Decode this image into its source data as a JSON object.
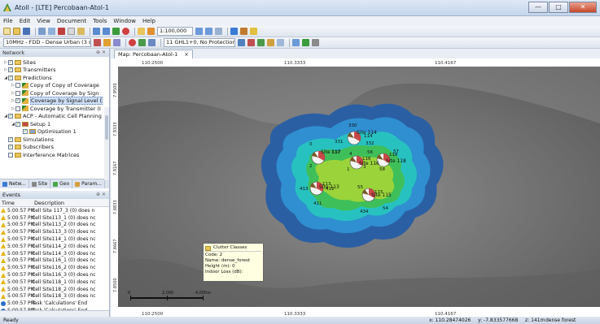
{
  "window": {
    "title": "Atoll - [LTE] Percobaan-Atol-1",
    "minimize": "—",
    "maximize": "□",
    "close": "✕"
  },
  "menu": [
    "File",
    "Edit",
    "View",
    "Document",
    "Tools",
    "Window",
    "Help"
  ],
  "toolbar": {
    "scale": "1:100,000",
    "frequency": "10MHz - FDD - Dense Urban (3 sec",
    "ghl": "11 GHL1+0, No Protection"
  },
  "network_panel": {
    "title": "Network",
    "items": [
      {
        "label": "Sites",
        "depth": 0,
        "twisty": "▷",
        "checked": true,
        "icon": "folder"
      },
      {
        "label": "Transmitters",
        "depth": 0,
        "twisty": "▷",
        "checked": true,
        "icon": "folder"
      },
      {
        "label": "Predictions",
        "depth": 0,
        "twisty": "◢",
        "checked": true,
        "icon": "folder"
      },
      {
        "label": "Copy of Copy of Coverage",
        "depth": 1,
        "twisty": "▷",
        "checked": false,
        "icon": "coverage"
      },
      {
        "label": "Copy of Coverage by Sign",
        "depth": 1,
        "twisty": "▷",
        "checked": false,
        "icon": "coverage"
      },
      {
        "label": "Coverage by Signal Level (",
        "depth": 1,
        "twisty": "▷",
        "checked": true,
        "icon": "coverage",
        "selected": true
      },
      {
        "label": "Coverage by Transmitter (I",
        "depth": 1,
        "twisty": "▷",
        "checked": false,
        "icon": "coverage"
      },
      {
        "label": "ACP - Automatic Cell Planning",
        "depth": 0,
        "twisty": "◢",
        "checked": true,
        "icon": "folder"
      },
      {
        "label": "Setup 1",
        "depth": 1,
        "twisty": "◢",
        "checked": true,
        "icon": "setup"
      },
      {
        "label": "Optimisation 1",
        "depth": 2,
        "twisty": "",
        "checked": true,
        "icon": "opt"
      },
      {
        "label": "Simulations",
        "depth": 0,
        "twisty": "",
        "checked": true,
        "icon": "folder"
      },
      {
        "label": "Subscribers",
        "depth": 0,
        "twisty": "",
        "checked": true,
        "icon": "folder"
      },
      {
        "label": "Interference Matrices",
        "depth": 0,
        "twisty": "",
        "checked": false,
        "icon": "folder"
      }
    ],
    "tabs": [
      {
        "label": "Netw...",
        "color": "#3a7bd5"
      },
      {
        "label": "Site",
        "color": "#888888"
      },
      {
        "label": "Geo",
        "color": "#4aa84a"
      },
      {
        "label": "Param...",
        "color": "#d4a040"
      }
    ]
  },
  "events_panel": {
    "title": "Events",
    "col_time": "Time",
    "col_desc": "Description",
    "rows": [
      {
        "time": "5:00:57 PM",
        "desc": "Cell Site 117_3 (0) does n"
      },
      {
        "time": "5:00:57 PM",
        "desc": "Cell Site113_1 (0) does nc"
      },
      {
        "time": "5:00:57 PM",
        "desc": "Cell Site113_2 (0) does nc"
      },
      {
        "time": "5:00:57 PM",
        "desc": "Cell Site113_3 (0) does nc"
      },
      {
        "time": "5:00:57 PM",
        "desc": "Cell Site114_1 (0) does nc"
      },
      {
        "time": "5:00:57 PM",
        "desc": "Cell Site114_2 (0) does nc"
      },
      {
        "time": "5:00:57 PM",
        "desc": "Cell Site114_3 (0) does nc"
      },
      {
        "time": "5:00:57 PM",
        "desc": "Cell Site116_1 (0) does nc"
      },
      {
        "time": "5:00:57 PM",
        "desc": "Cell Site116_2 (0) does nc"
      },
      {
        "time": "5:00:57 PM",
        "desc": "Cell Site116_3 (0) does nc"
      },
      {
        "time": "5:00:57 PM",
        "desc": "Cell Site118_1 (0) does nc"
      },
      {
        "time": "5:00:57 PM",
        "desc": "Cell Site118_2 (0) does nc"
      },
      {
        "time": "5:00:57 PM",
        "desc": "Cell Site118_3 (0) does nc"
      },
      {
        "time": "5:00:57 PM",
        "desc": "Task 'Calculations' End"
      },
      {
        "time": "5:00:57 PM",
        "desc": "Task 'Calculations' End"
      }
    ]
  },
  "map": {
    "tab_label": "Map: Percobaan-Atol-1",
    "tab_close": "×",
    "top_ticks": [
      "110.2500",
      "110.3333",
      "110.4167"
    ],
    "bottom_ticks": [
      "110.2500",
      "110.3333",
      "110.4167"
    ],
    "left_ticks": [
      "7.9500",
      "7.9333",
      "7.9167",
      "7.8833",
      "7.8667",
      "7.8500"
    ],
    "scalebar": {
      "start": "0",
      "mid": "2,000",
      "end": "4,000m"
    },
    "site_labels": [
      "330",
      "114",
      "332",
      "331",
      "117",
      "116",
      "118",
      "113",
      "115",
      "434",
      "55",
      "57",
      "4",
      "0",
      "2",
      "411",
      "413",
      "412",
      "54",
      "56",
      "58",
      "3",
      "1"
    ],
    "site_names": [
      "Site 117",
      "Site 114",
      "Site 116",
      "Site 118",
      "Site 113",
      "Site 115"
    ]
  },
  "tooltip": {
    "title": "Clutter Classes",
    "lines": [
      "Code: 2",
      "Name: dense_forest",
      "Height (m): 0",
      "Indoor Loss (dB):"
    ]
  },
  "statusbar": {
    "ready": "Ready",
    "x": "x: 110.28474026",
    "y": "y: -7.833577668",
    "z": "z: 141m",
    "clutter": "dense forest"
  }
}
